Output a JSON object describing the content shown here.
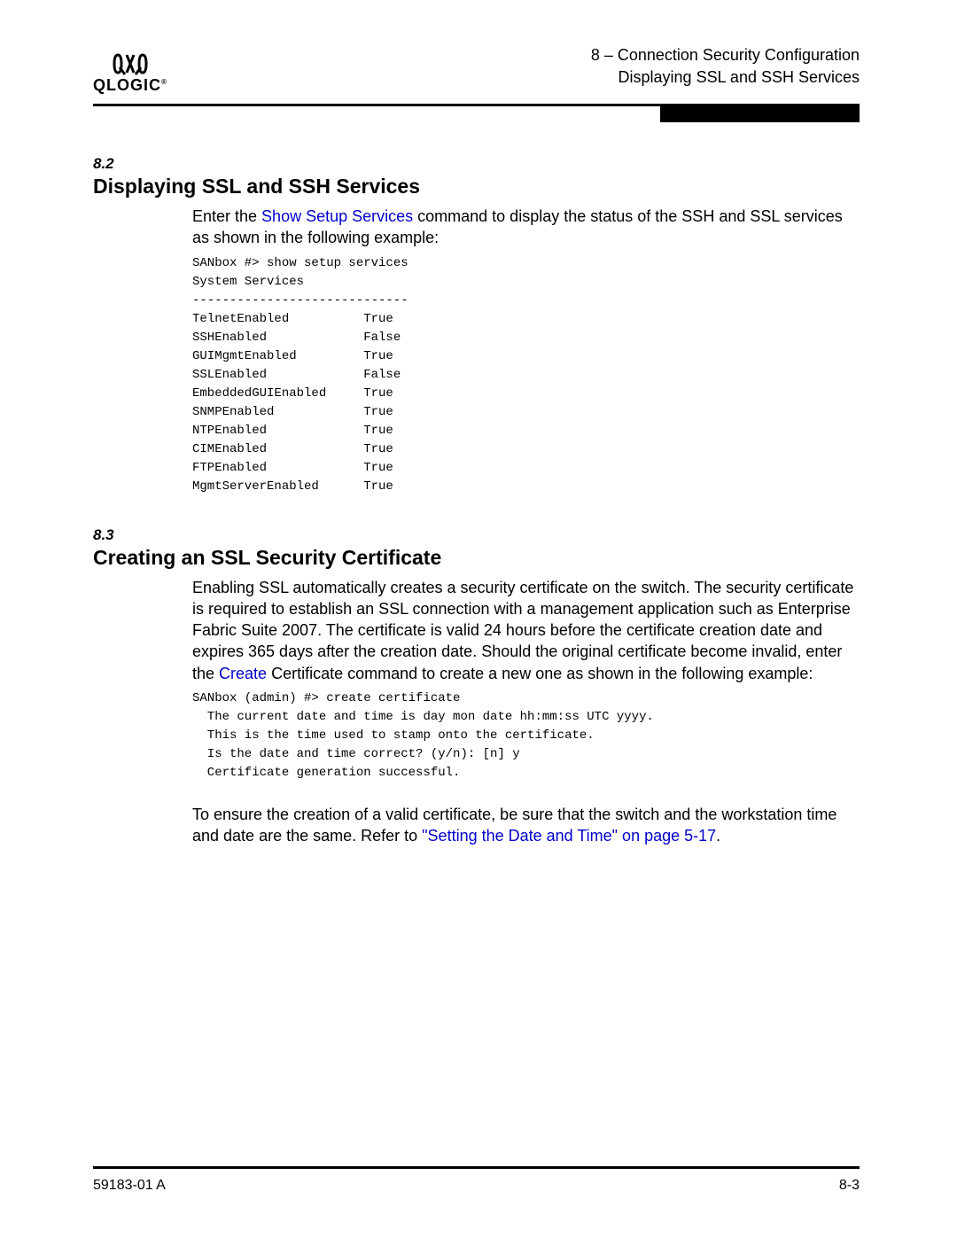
{
  "header": {
    "logo_glyph": "xx",
    "logo_text": "QLOGIC",
    "logo_mark": "®",
    "right_line1": "8 – Connection Security Configuration",
    "right_line2": "Displaying SSL and SSH Services"
  },
  "section_8_2": {
    "num": "8.2",
    "heading": "Displaying SSL and SSH Services",
    "intro_pre": "Enter the ",
    "intro_link": "Show Setup Services",
    "intro_post": " command to display the status of the SSH and SSL services as shown in the following example:",
    "code": "SANbox #> show setup services\nSystem Services\n-----------------------------\nTelnetEnabled          True\nSSHEnabled             False\nGUIMgmtEnabled         True\nSSLEnabled             False\nEmbeddedGUIEnabled     True\nSNMPEnabled            True\nNTPEnabled             True\nCIMEnabled             True\nFTPEnabled             True\nMgmtServerEnabled      True"
  },
  "section_8_3": {
    "num": "8.3",
    "heading": "Creating an SSL Security Certificate",
    "para1_pre": "Enabling SSL automatically creates a security certificate on the switch. The security certificate is required to establish an SSL connection with a management application such as Enterprise Fabric Suite 2007. The certificate is valid 24 hours before the certificate creation date and expires 365 days after the creation date. Should the original certificate become invalid, enter the ",
    "para1_link": "Create",
    "para1_post": " Certificate command to create a new one as shown in the following example:",
    "code": "SANbox (admin) #> create certificate\n  The current date and time is day mon date hh:mm:ss UTC yyyy.\n  This is the time used to stamp onto the certificate.\n  Is the date and time correct? (y/n): [n] y\n  Certificate generation successful.",
    "para2_pre": "To ensure the creation of a valid certificate, be sure that the switch and the workstation time and date are the same. Refer to ",
    "para2_link": "\"Setting the Date and Time\" on page 5-17",
    "para2_post": "."
  },
  "footer": {
    "left": "59183-01 A",
    "right": "8-3"
  }
}
